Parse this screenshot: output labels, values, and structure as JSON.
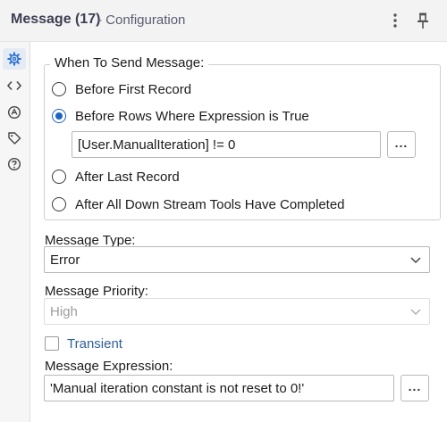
{
  "header": {
    "title": "Message (17)",
    "subtitle": "- Configuration",
    "more_icon": "kebab-menu-icon",
    "pin_icon": "pin-icon"
  },
  "rail": {
    "items": [
      {
        "icon": "gear-icon",
        "active": true
      },
      {
        "icon": "code-icon",
        "active": false
      },
      {
        "icon": "annotation-icon",
        "active": false
      },
      {
        "icon": "tag-icon",
        "active": false
      },
      {
        "icon": "help-icon",
        "active": false
      }
    ]
  },
  "when_to_send": {
    "legend": "When To Send Message:",
    "options": [
      {
        "label": "Before First Record",
        "checked": false
      },
      {
        "label": "Before Rows Where Expression is True",
        "checked": true
      },
      {
        "label": "After Last Record",
        "checked": false
      },
      {
        "label": "After All Down Stream Tools Have Completed",
        "checked": false
      }
    ],
    "expression_value": "[User.ManualIteration] != 0",
    "expression_button": "..."
  },
  "message_type": {
    "label": "Message Type:",
    "value": "Error"
  },
  "message_priority": {
    "label": "Message Priority:",
    "value": "High"
  },
  "transient": {
    "label": "Transient",
    "checked": false
  },
  "message_expression": {
    "label": "Message Expression:",
    "value": "'Manual iteration constant is not reset to 0!'",
    "button": "..."
  },
  "colors": {
    "accent": "#1e63c6",
    "link_text": "#2f5f9e",
    "disabled_text": "#9d9d9d"
  }
}
